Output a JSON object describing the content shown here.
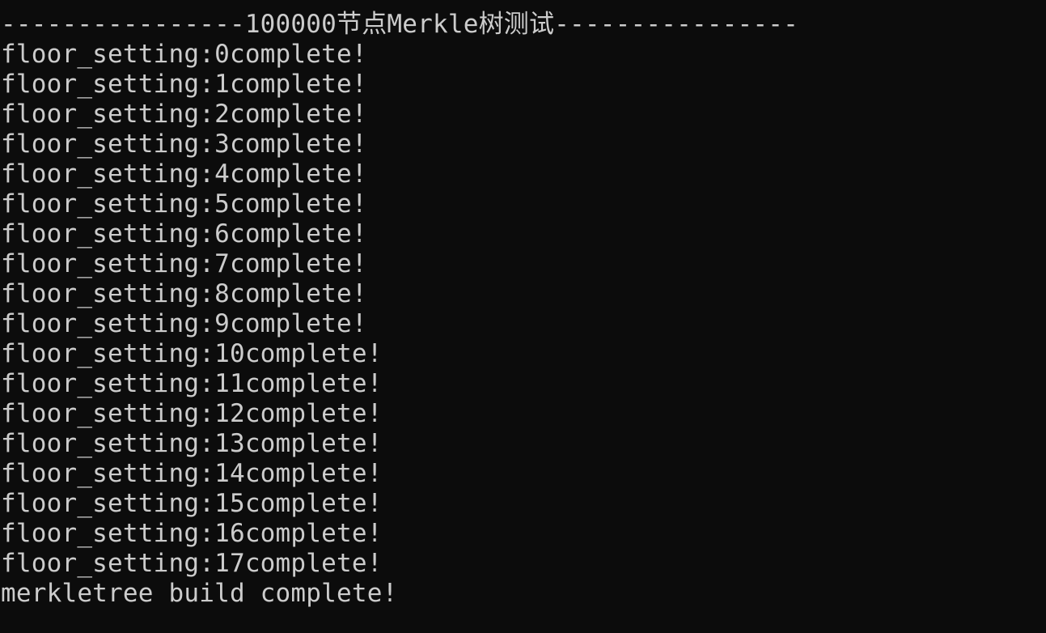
{
  "terminal": {
    "header": "----------------100000节点Merkle树测试----------------",
    "lines": [
      "floor_setting:0complete!",
      "floor_setting:1complete!",
      "floor_setting:2complete!",
      "floor_setting:3complete!",
      "floor_setting:4complete!",
      "floor_setting:5complete!",
      "floor_setting:6complete!",
      "floor_setting:7complete!",
      "floor_setting:8complete!",
      "floor_setting:9complete!",
      "floor_setting:10complete!",
      "floor_setting:11complete!",
      "floor_setting:12complete!",
      "floor_setting:13complete!",
      "floor_setting:14complete!",
      "floor_setting:15complete!",
      "floor_setting:16complete!",
      "floor_setting:17complete!"
    ],
    "footer": "merkletree build complete!"
  },
  "colors": {
    "background": "#0c0c0c",
    "foreground": "#cccccc"
  }
}
